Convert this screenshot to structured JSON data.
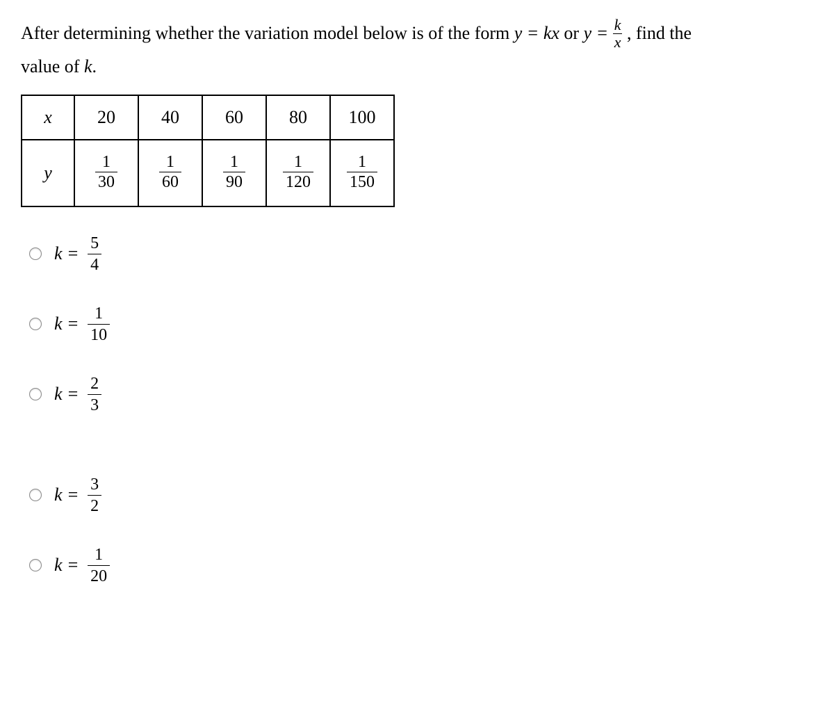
{
  "question": {
    "line1_prefix": "After determining whether the variation model below is of the form ",
    "eq1_lhs": "y",
    "eq1_rhs": "kx",
    "or": " or ",
    "eq2_lhs": "y",
    "eq2_rhs_num": "k",
    "eq2_rhs_den": "x",
    "line1_suffix": ", find the",
    "line2": "value of ",
    "var_k": "k",
    "period": "."
  },
  "table": {
    "row_x_label": "x",
    "row_y_label": "y",
    "x": [
      "20",
      "40",
      "60",
      "80",
      "100"
    ],
    "y": [
      {
        "num": "1",
        "den": "30"
      },
      {
        "num": "1",
        "den": "60"
      },
      {
        "num": "1",
        "den": "90"
      },
      {
        "num": "1",
        "den": "120"
      },
      {
        "num": "1",
        "den": "150"
      }
    ]
  },
  "options": [
    {
      "lhs": "k",
      "num": "5",
      "den": "4"
    },
    {
      "lhs": "k",
      "num": "1",
      "den": "10"
    },
    {
      "lhs": "k",
      "num": "2",
      "den": "3"
    },
    {
      "lhs": "k",
      "num": "3",
      "den": "2"
    },
    {
      "lhs": "k",
      "num": "1",
      "den": "20"
    }
  ]
}
